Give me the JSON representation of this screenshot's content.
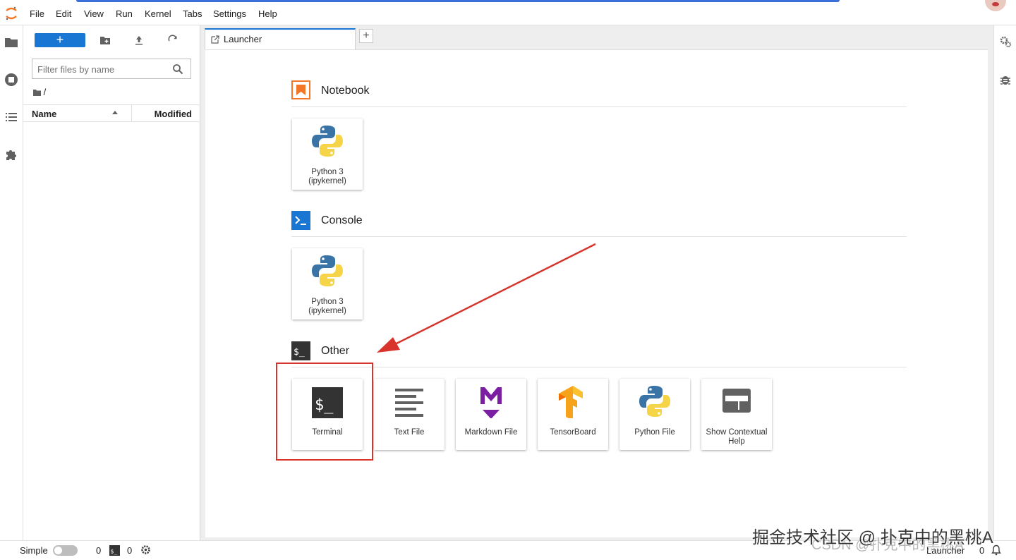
{
  "menubar": {
    "items": [
      "File",
      "Edit",
      "View",
      "Run",
      "Kernel",
      "Tabs",
      "Settings",
      "Help"
    ]
  },
  "filebrowser": {
    "new_label": "+",
    "filter_placeholder": "Filter files by name",
    "breadcrumb": "/",
    "col_name": "Name",
    "col_modified": "Modified"
  },
  "tabs": {
    "active_label": "Launcher",
    "add_label": "+"
  },
  "launcher": {
    "notebook_title": "Notebook",
    "notebook_cards": [
      {
        "label": "Python 3 (ipykernel)",
        "icon": "python-logo-icon"
      }
    ],
    "console_title": "Console",
    "console_cards": [
      {
        "label": "Python 3 (ipykernel)",
        "icon": "python-logo-icon"
      }
    ],
    "other_title": "Other",
    "other_cards": [
      {
        "label": "Terminal",
        "icon": "terminal-icon"
      },
      {
        "label": "Text File",
        "icon": "text-file-icon"
      },
      {
        "label": "Markdown File",
        "icon": "markdown-icon"
      },
      {
        "label": "TensorBoard",
        "icon": "tensorboard-icon"
      },
      {
        "label": "Python File",
        "icon": "python-logo-icon"
      },
      {
        "label": "Show Contextual Help",
        "icon": "contextual-help-icon"
      }
    ]
  },
  "statusbar": {
    "mode_label": "Simple",
    "kernels_count": "0",
    "terminals_count": "0",
    "right_label": "Launcher",
    "right_count": "0"
  },
  "watermark": {
    "text": "掘金技术社区 @ 扑克中的黑桃A",
    "sub_text": "CSDN @扑克中的黑桃A"
  },
  "colors": {
    "accent": "#1976d2",
    "notebook_orange": "#f37726",
    "console_blue": "#1976d2",
    "markdown_purple": "#7b1fa2",
    "annotation_red": "#d9342b"
  }
}
